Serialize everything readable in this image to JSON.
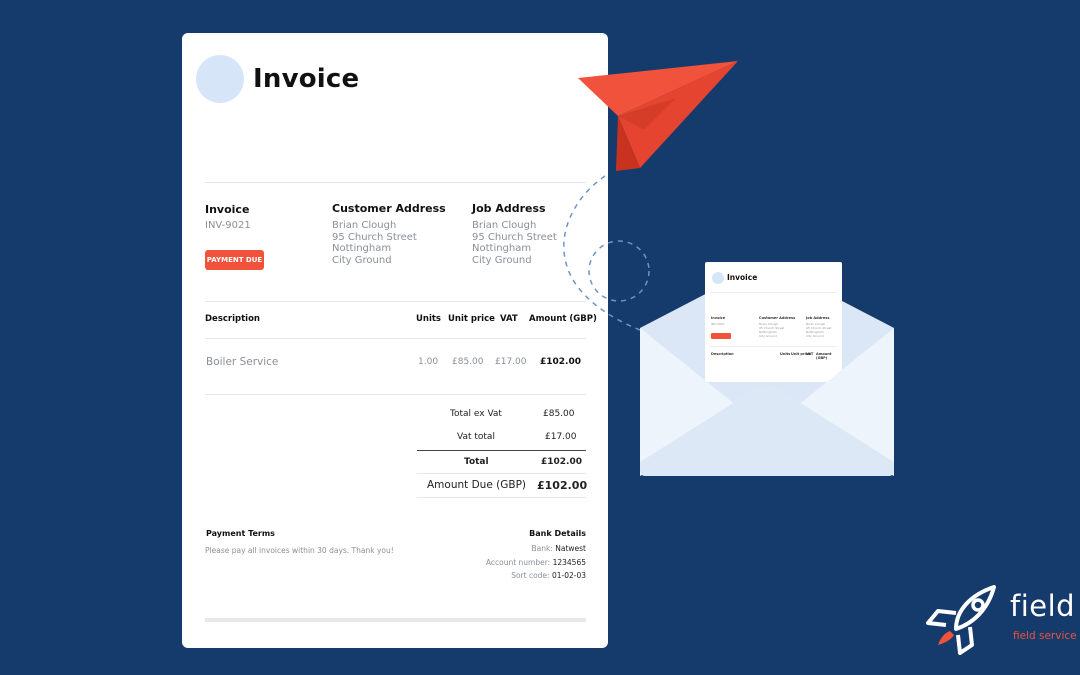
{
  "invoice": {
    "heading": "Invoice",
    "invoice_label": "Invoice",
    "invoice_number": "INV-9021",
    "status_badge": "PAYMENT DUE",
    "customer_address": {
      "label": "Customer Address",
      "lines": [
        "Brian Clough",
        "95 Church Street",
        "Nottingham",
        "City Ground"
      ]
    },
    "job_address": {
      "label": "Job Address",
      "lines": [
        "Brian Clough",
        "95 Church Street",
        "Nottingham",
        "City Ground"
      ]
    },
    "table": {
      "headers": [
        "Description",
        "Units",
        "Unit price",
        "VAT",
        "Amount (GBP)"
      ],
      "rows": [
        {
          "description": "Boiler Service",
          "units": "1.00",
          "unit_price": "£85.00",
          "vat": "£17.00",
          "amount": "£102.00"
        }
      ]
    },
    "totals": {
      "ex_vat_label": "Total ex Vat",
      "ex_vat": "£85.00",
      "vat_label": "Vat total",
      "vat": "£17.00",
      "total_label": "Total",
      "total": "£102.00",
      "due_label": "Amount Due (GBP)",
      "due": "£102.00"
    },
    "payment_terms": {
      "label": "Payment Terms",
      "text": "Please pay all invoices within 30 days. Thank you!"
    },
    "bank_details": {
      "label": "Bank Details",
      "bank_label": "Bank:",
      "bank": "Natwest",
      "account_label": "Account number:",
      "account": "1234565",
      "sort_label": "Sort code:",
      "sort": "01-02-03"
    }
  },
  "mini_invoice": {
    "heading": "Invoice",
    "invoice_label": "Invoice",
    "customer_label": "Customer Address",
    "job_label": "Job Address",
    "table_headers": [
      "Description",
      "Units",
      "Unit price",
      "VAT",
      "Amount (GBP)"
    ]
  },
  "brand": {
    "wordmark": "field",
    "tagline": "field service m"
  },
  "colors": {
    "background": "#153b6c",
    "accent": "#f0523b",
    "logo_placeholder": "#d6e6f8",
    "envelope": "#e9f1fb"
  },
  "icons": [
    "paper-plane-icon",
    "envelope-icon",
    "rocket-icon"
  ]
}
